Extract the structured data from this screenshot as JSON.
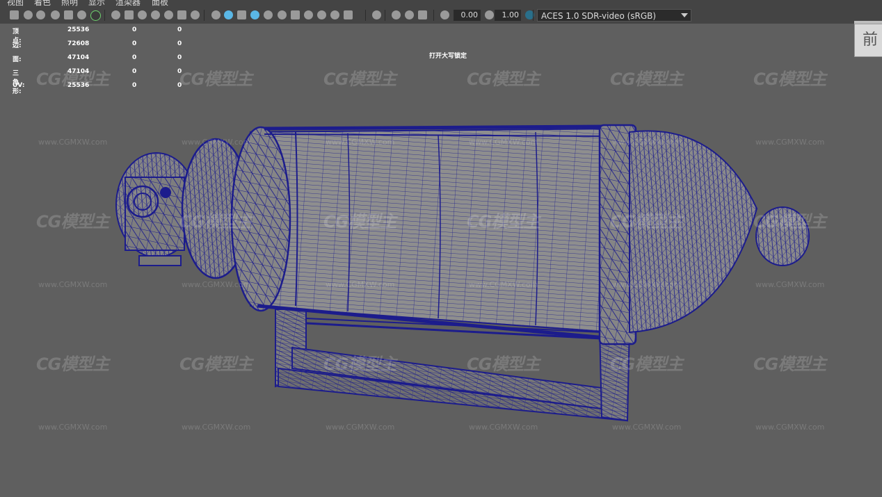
{
  "menu": [
    "视图",
    "着色",
    "照明",
    "显示",
    "渲染器",
    "面板"
  ],
  "toolbar": {
    "exposure": "0.00",
    "gamma": "1.00",
    "color_space": "ACES 1.0 SDR-video (sRGB)",
    "icons": [
      "camera-icon",
      "select-camera-icon",
      "lock-camera-icon",
      "bookmark-icon",
      "image-plane-icon",
      "2d-pan-icon",
      "grease-pencil-icon",
      "grid-icon",
      "film-gate-icon",
      "resolution-gate-icon",
      "gate-mask-icon",
      "field-chart-icon",
      "safe-action-icon",
      "safe-title-icon",
      "wireframe-icon",
      "smooth-shade-icon",
      "default-material-icon",
      "wireframe-on-shaded-icon",
      "xray-icon",
      "use-default-light-icon",
      "shadows-icon",
      "screen-space-ao-icon",
      "motion-blur-icon",
      "anti-alias-icon",
      "depth-of-field-icon",
      "isolate-select-icon",
      "xray-joints-icon",
      "xray-active-icon",
      "backface-icon",
      "exposure-icon",
      "gamma-icon",
      "color-mgmt-icon"
    ]
  },
  "hud": {
    "rows": [
      {
        "label": "顶点:",
        "v1": "25536",
        "v2": "0",
        "v3": "0"
      },
      {
        "label": "边:",
        "v1": "72608",
        "v2": "0",
        "v3": "0"
      },
      {
        "label": "面:",
        "v1": "47104",
        "v2": "0",
        "v3": "0"
      },
      {
        "label": "三角形:",
        "v1": "47104",
        "v2": "0",
        "v3": "0"
      },
      {
        "label": "UV:",
        "v1": "25536",
        "v2": "0",
        "v3": "0"
      }
    ],
    "caps_lock": "打开大写锁定"
  },
  "viewcube": {
    "face": "前"
  },
  "watermark": {
    "logo": "CG模型主",
    "url": "www.CGMXW.com"
  },
  "colors": {
    "wire": "#1c1c8c",
    "surface": "#8a8a8a",
    "background": "#5f5f5f",
    "toolbar": "#444444"
  }
}
